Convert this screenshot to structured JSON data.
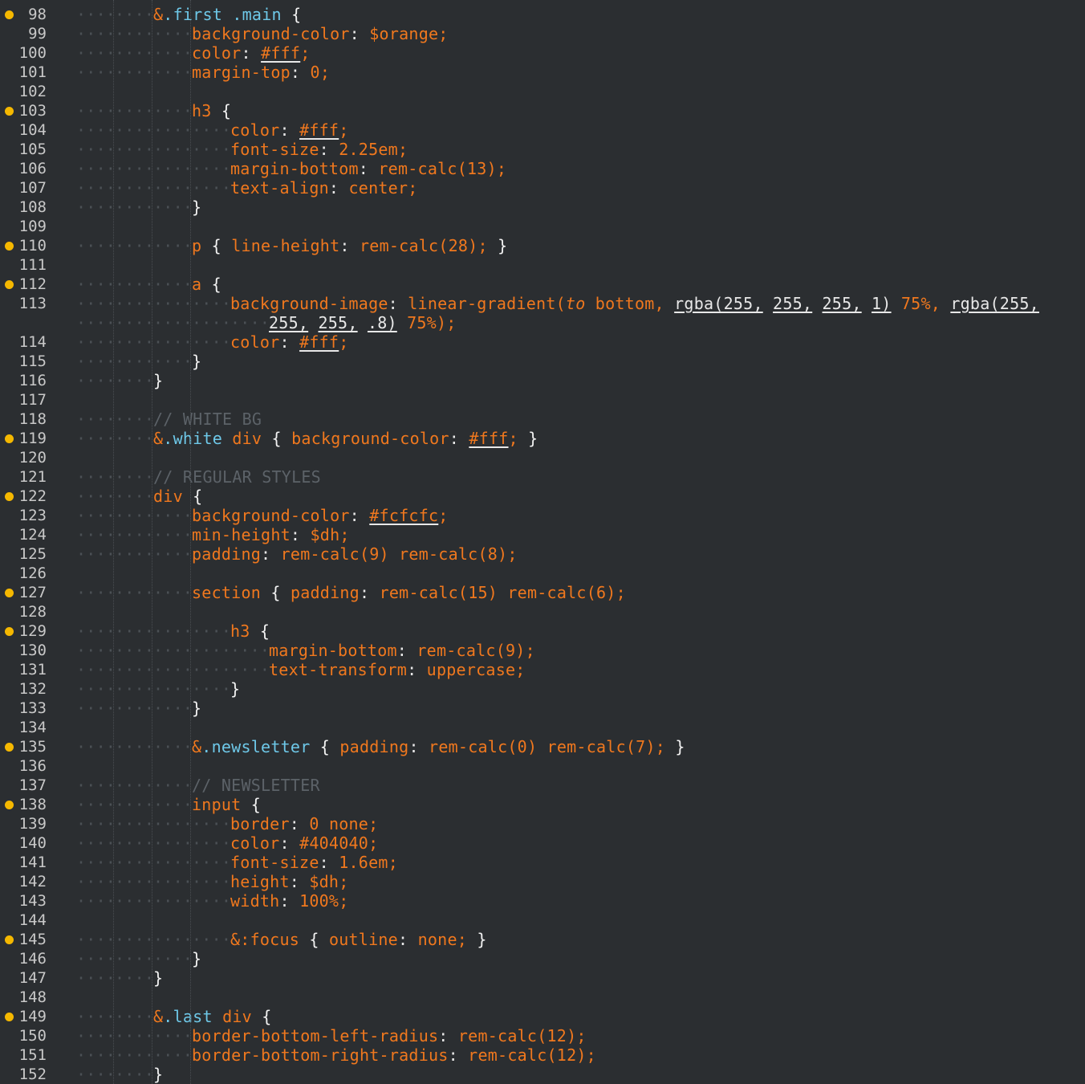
{
  "editor": {
    "lines": [
      {
        "n": "98",
        "dot": true,
        "i": 2,
        "t": [
          [
            "&",
            "amp"
          ],
          [
            ".first",
            "cls"
          ],
          [
            " ",
            "ws"
          ],
          [
            ".main",
            "cls"
          ],
          [
            " ",
            "ws"
          ],
          [
            "{",
            "brace"
          ]
        ]
      },
      {
        "n": "99",
        "dot": false,
        "i": 3,
        "t": [
          [
            "background-color",
            "prop"
          ],
          [
            ":",
            "punc"
          ],
          [
            " ",
            "ws"
          ],
          [
            "$orange",
            "val"
          ],
          [
            ";",
            "val"
          ]
        ]
      },
      {
        "n": "100",
        "dot": false,
        "i": 3,
        "t": [
          [
            "color",
            "prop"
          ],
          [
            ":",
            "punc"
          ],
          [
            " ",
            "ws"
          ],
          [
            "#fff",
            "hex"
          ],
          [
            ";",
            "val"
          ]
        ]
      },
      {
        "n": "101",
        "dot": false,
        "i": 3,
        "t": [
          [
            "margin-top",
            "prop"
          ],
          [
            ":",
            "punc"
          ],
          [
            " ",
            "ws"
          ],
          [
            "0",
            "num"
          ],
          [
            ";",
            "val"
          ]
        ]
      },
      {
        "n": "102",
        "dot": false,
        "i": 0,
        "t": []
      },
      {
        "n": "103",
        "dot": true,
        "i": 3,
        "t": [
          [
            "h3",
            "sel"
          ],
          [
            " ",
            "ws"
          ],
          [
            "{",
            "brace"
          ]
        ]
      },
      {
        "n": "104",
        "dot": false,
        "i": 4,
        "t": [
          [
            "color",
            "prop"
          ],
          [
            ":",
            "punc"
          ],
          [
            " ",
            "ws"
          ],
          [
            "#fff",
            "hex"
          ],
          [
            ";",
            "val"
          ]
        ]
      },
      {
        "n": "105",
        "dot": false,
        "i": 4,
        "t": [
          [
            "font-size",
            "prop"
          ],
          [
            ":",
            "punc"
          ],
          [
            " ",
            "ws"
          ],
          [
            "2.25em",
            "num"
          ],
          [
            ";",
            "val"
          ]
        ]
      },
      {
        "n": "106",
        "dot": false,
        "i": 4,
        "t": [
          [
            "margin-bottom",
            "prop"
          ],
          [
            ":",
            "punc"
          ],
          [
            " ",
            "ws"
          ],
          [
            "rem-calc(13)",
            "val"
          ],
          [
            ";",
            "val"
          ]
        ]
      },
      {
        "n": "107",
        "dot": false,
        "i": 4,
        "t": [
          [
            "text-align",
            "prop"
          ],
          [
            ":",
            "punc"
          ],
          [
            " ",
            "ws"
          ],
          [
            "center",
            "val"
          ],
          [
            ";",
            "val"
          ]
        ]
      },
      {
        "n": "108",
        "dot": false,
        "i": 3,
        "t": [
          [
            "}",
            "brace"
          ]
        ]
      },
      {
        "n": "109",
        "dot": false,
        "i": 0,
        "t": []
      },
      {
        "n": "110",
        "dot": true,
        "i": 3,
        "t": [
          [
            "p",
            "sel"
          ],
          [
            " ",
            "ws"
          ],
          [
            "{",
            "brace"
          ],
          [
            " ",
            "ws"
          ],
          [
            "line-height",
            "prop"
          ],
          [
            ":",
            "punc"
          ],
          [
            " ",
            "ws"
          ],
          [
            "rem-calc(28)",
            "val"
          ],
          [
            ";",
            "val"
          ],
          [
            " ",
            "ws"
          ],
          [
            "}",
            "brace"
          ]
        ]
      },
      {
        "n": "111",
        "dot": false,
        "i": 0,
        "t": []
      },
      {
        "n": "112",
        "dot": true,
        "i": 3,
        "t": [
          [
            "a",
            "sel"
          ],
          [
            " ",
            "ws"
          ],
          [
            "{",
            "brace"
          ]
        ]
      },
      {
        "n": "113",
        "dot": false,
        "i": 4,
        "t": [
          [
            "background-image",
            "prop"
          ],
          [
            ":",
            "punc"
          ],
          [
            " ",
            "ws"
          ],
          [
            "linear-gradient(",
            "val"
          ],
          [
            "to",
            "kw"
          ],
          [
            " bottom, ",
            "val"
          ],
          [
            "rgba(255,",
            "ul"
          ],
          [
            " ",
            "val"
          ],
          [
            "255,",
            "ul"
          ],
          [
            " ",
            "val"
          ],
          [
            "255,",
            "ul"
          ],
          [
            " ",
            "val"
          ],
          [
            "1)",
            "ul"
          ],
          [
            " 75%, ",
            "val"
          ],
          [
            "rgba(255,",
            "ul"
          ]
        ]
      },
      {
        "n": "",
        "dot": false,
        "i": 5,
        "t": [
          [
            "255,",
            "ul"
          ],
          [
            " ",
            "val"
          ],
          [
            "255,",
            "ul"
          ],
          [
            " ",
            "val"
          ],
          [
            ".8)",
            "ul"
          ],
          [
            " 75%);",
            "val"
          ]
        ]
      },
      {
        "n": "114",
        "dot": false,
        "i": 4,
        "t": [
          [
            "color",
            "prop"
          ],
          [
            ":",
            "punc"
          ],
          [
            " ",
            "ws"
          ],
          [
            "#fff",
            "hex"
          ],
          [
            ";",
            "val"
          ]
        ]
      },
      {
        "n": "115",
        "dot": false,
        "i": 3,
        "t": [
          [
            "}",
            "brace"
          ]
        ]
      },
      {
        "n": "116",
        "dot": false,
        "i": 2,
        "t": [
          [
            "}",
            "brace"
          ]
        ]
      },
      {
        "n": "117",
        "dot": false,
        "i": 0,
        "t": []
      },
      {
        "n": "118",
        "dot": false,
        "i": 2,
        "t": [
          [
            "// WHITE BG",
            "com"
          ]
        ]
      },
      {
        "n": "119",
        "dot": true,
        "i": 2,
        "t": [
          [
            "&",
            "amp"
          ],
          [
            ".white",
            "cls"
          ],
          [
            " ",
            "ws"
          ],
          [
            "div",
            "sel"
          ],
          [
            " ",
            "ws"
          ],
          [
            "{",
            "brace"
          ],
          [
            " ",
            "ws"
          ],
          [
            "background-color",
            "prop"
          ],
          [
            ":",
            "punc"
          ],
          [
            " ",
            "ws"
          ],
          [
            "#fff",
            "hex"
          ],
          [
            ";",
            "val"
          ],
          [
            " ",
            "ws"
          ],
          [
            "}",
            "brace"
          ]
        ]
      },
      {
        "n": "120",
        "dot": false,
        "i": 0,
        "t": []
      },
      {
        "n": "121",
        "dot": false,
        "i": 2,
        "t": [
          [
            "// REGULAR STYLES",
            "com"
          ]
        ]
      },
      {
        "n": "122",
        "dot": true,
        "i": 2,
        "t": [
          [
            "div",
            "sel"
          ],
          [
            " ",
            "ws"
          ],
          [
            "{",
            "brace"
          ]
        ]
      },
      {
        "n": "123",
        "dot": false,
        "i": 3,
        "t": [
          [
            "background-color",
            "prop"
          ],
          [
            ":",
            "punc"
          ],
          [
            " ",
            "ws"
          ],
          [
            "#fcfcfc",
            "hex"
          ],
          [
            ";",
            "val"
          ]
        ]
      },
      {
        "n": "124",
        "dot": false,
        "i": 3,
        "t": [
          [
            "min-height",
            "prop"
          ],
          [
            ":",
            "punc"
          ],
          [
            " ",
            "ws"
          ],
          [
            "$dh",
            "val"
          ],
          [
            ";",
            "val"
          ]
        ]
      },
      {
        "n": "125",
        "dot": false,
        "i": 3,
        "t": [
          [
            "padding",
            "prop"
          ],
          [
            ":",
            "punc"
          ],
          [
            " ",
            "ws"
          ],
          [
            "rem-calc(9)",
            "val"
          ],
          [
            " ",
            "ws"
          ],
          [
            "rem-calc(8)",
            "val"
          ],
          [
            ";",
            "val"
          ]
        ]
      },
      {
        "n": "126",
        "dot": false,
        "i": 0,
        "t": []
      },
      {
        "n": "127",
        "dot": true,
        "i": 3,
        "t": [
          [
            "section",
            "sel"
          ],
          [
            " ",
            "ws"
          ],
          [
            "{",
            "brace"
          ],
          [
            " ",
            "ws"
          ],
          [
            "padding",
            "prop"
          ],
          [
            ":",
            "punc"
          ],
          [
            " ",
            "ws"
          ],
          [
            "rem-calc(15)",
            "val"
          ],
          [
            " ",
            "ws"
          ],
          [
            "rem-calc(6)",
            "val"
          ],
          [
            ";",
            "val"
          ]
        ]
      },
      {
        "n": "128",
        "dot": false,
        "i": 0,
        "t": []
      },
      {
        "n": "129",
        "dot": true,
        "i": 4,
        "t": [
          [
            "h3",
            "sel"
          ],
          [
            " ",
            "ws"
          ],
          [
            "{",
            "brace"
          ]
        ]
      },
      {
        "n": "130",
        "dot": false,
        "i": 5,
        "t": [
          [
            "margin-bottom",
            "prop"
          ],
          [
            ":",
            "punc"
          ],
          [
            " ",
            "ws"
          ],
          [
            "rem-calc(9)",
            "val"
          ],
          [
            ";",
            "val"
          ]
        ]
      },
      {
        "n": "131",
        "dot": false,
        "i": 5,
        "t": [
          [
            "text-transform",
            "prop"
          ],
          [
            ":",
            "punc"
          ],
          [
            " ",
            "ws"
          ],
          [
            "uppercase",
            "val"
          ],
          [
            ";",
            "val"
          ]
        ]
      },
      {
        "n": "132",
        "dot": false,
        "i": 4,
        "t": [
          [
            "}",
            "brace"
          ]
        ]
      },
      {
        "n": "133",
        "dot": false,
        "i": 3,
        "t": [
          [
            "}",
            "brace"
          ]
        ]
      },
      {
        "n": "134",
        "dot": false,
        "i": 0,
        "t": []
      },
      {
        "n": "135",
        "dot": true,
        "i": 3,
        "t": [
          [
            "&",
            "amp"
          ],
          [
            ".newsletter",
            "cls"
          ],
          [
            " ",
            "ws"
          ],
          [
            "{",
            "brace"
          ],
          [
            " ",
            "ws"
          ],
          [
            "padding",
            "prop"
          ],
          [
            ":",
            "punc"
          ],
          [
            " ",
            "ws"
          ],
          [
            "rem-calc(0)",
            "val"
          ],
          [
            " ",
            "ws"
          ],
          [
            "rem-calc(7)",
            "val"
          ],
          [
            ";",
            "val"
          ],
          [
            " ",
            "ws"
          ],
          [
            "}",
            "brace"
          ]
        ]
      },
      {
        "n": "136",
        "dot": false,
        "i": 0,
        "t": []
      },
      {
        "n": "137",
        "dot": false,
        "i": 3,
        "t": [
          [
            "// NEWSLETTER",
            "com"
          ]
        ]
      },
      {
        "n": "138",
        "dot": true,
        "i": 3,
        "t": [
          [
            "input",
            "sel"
          ],
          [
            " ",
            "ws"
          ],
          [
            "{",
            "brace"
          ]
        ]
      },
      {
        "n": "139",
        "dot": false,
        "i": 4,
        "t": [
          [
            "border",
            "prop"
          ],
          [
            ":",
            "punc"
          ],
          [
            " ",
            "ws"
          ],
          [
            "0",
            "num"
          ],
          [
            " ",
            "ws"
          ],
          [
            "none",
            "val"
          ],
          [
            ";",
            "val"
          ]
        ]
      },
      {
        "n": "140",
        "dot": false,
        "i": 4,
        "t": [
          [
            "color",
            "prop"
          ],
          [
            ":",
            "punc"
          ],
          [
            " ",
            "ws"
          ],
          [
            "#404040",
            "val"
          ],
          [
            ";",
            "val"
          ]
        ]
      },
      {
        "n": "141",
        "dot": false,
        "i": 4,
        "t": [
          [
            "font-size",
            "prop"
          ],
          [
            ":",
            "punc"
          ],
          [
            " ",
            "ws"
          ],
          [
            "1.6em",
            "num"
          ],
          [
            ";",
            "val"
          ]
        ]
      },
      {
        "n": "142",
        "dot": false,
        "i": 4,
        "t": [
          [
            "height",
            "prop"
          ],
          [
            ":",
            "punc"
          ],
          [
            " ",
            "ws"
          ],
          [
            "$dh",
            "val"
          ],
          [
            ";",
            "val"
          ]
        ]
      },
      {
        "n": "143",
        "dot": false,
        "i": 4,
        "t": [
          [
            "width",
            "prop"
          ],
          [
            ":",
            "punc"
          ],
          [
            " ",
            "ws"
          ],
          [
            "100%",
            "num"
          ],
          [
            ";",
            "val"
          ]
        ]
      },
      {
        "n": "144",
        "dot": false,
        "i": 0,
        "t": []
      },
      {
        "n": "145",
        "dot": true,
        "i": 4,
        "t": [
          [
            "&:focus",
            "amp"
          ],
          [
            " ",
            "ws"
          ],
          [
            "{",
            "brace"
          ],
          [
            " ",
            "ws"
          ],
          [
            "outline",
            "prop"
          ],
          [
            ":",
            "punc"
          ],
          [
            " ",
            "ws"
          ],
          [
            "none",
            "val"
          ],
          [
            ";",
            "val"
          ],
          [
            " ",
            "ws"
          ],
          [
            "}",
            "brace"
          ]
        ]
      },
      {
        "n": "146",
        "dot": false,
        "i": 3,
        "t": [
          [
            "}",
            "brace"
          ]
        ]
      },
      {
        "n": "147",
        "dot": false,
        "i": 2,
        "t": [
          [
            "}",
            "brace"
          ]
        ]
      },
      {
        "n": "148",
        "dot": false,
        "i": 0,
        "t": []
      },
      {
        "n": "149",
        "dot": true,
        "i": 2,
        "t": [
          [
            "&",
            "amp"
          ],
          [
            ".last",
            "cls"
          ],
          [
            " ",
            "ws"
          ],
          [
            "div",
            "sel"
          ],
          [
            " ",
            "ws"
          ],
          [
            "{",
            "brace"
          ]
        ]
      },
      {
        "n": "150",
        "dot": false,
        "i": 3,
        "t": [
          [
            "border-bottom-left-radius",
            "prop"
          ],
          [
            ":",
            "punc"
          ],
          [
            " ",
            "ws"
          ],
          [
            "rem-calc(12)",
            "val"
          ],
          [
            ";",
            "val"
          ]
        ]
      },
      {
        "n": "151",
        "dot": false,
        "i": 3,
        "t": [
          [
            "border-bottom-right-radius",
            "prop"
          ],
          [
            ":",
            "punc"
          ],
          [
            " ",
            "ws"
          ],
          [
            "rem-calc(12)",
            "val"
          ],
          [
            ";",
            "val"
          ]
        ]
      },
      {
        "n": "152",
        "dot": false,
        "i": 2,
        "t": [
          [
            "}",
            "brace"
          ]
        ]
      }
    ]
  }
}
